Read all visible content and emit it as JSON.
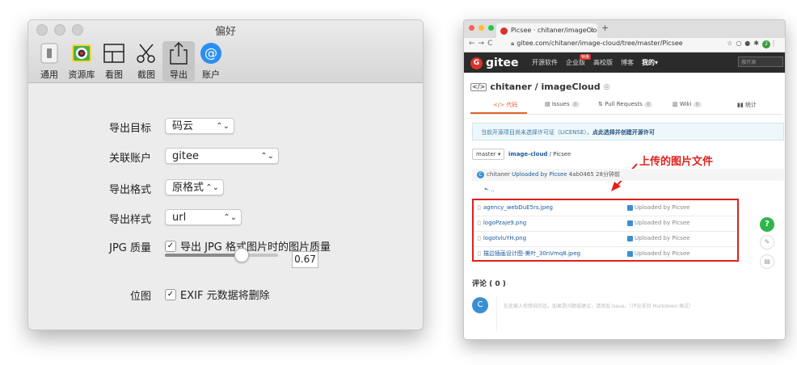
{
  "prefs": {
    "title": "偏好",
    "toolbar": [
      {
        "label": "通用",
        "icon": "switch-icon"
      },
      {
        "label": "资源库",
        "icon": "photo-library-icon"
      },
      {
        "label": "看图",
        "icon": "grid-view-icon"
      },
      {
        "label": "截图",
        "icon": "scissors-icon"
      },
      {
        "label": "导出",
        "icon": "share-export-icon",
        "selected": true
      },
      {
        "label": "账户",
        "icon": "at-sign-icon"
      }
    ],
    "export_target": {
      "label": "导出目标",
      "value": "码云"
    },
    "linked_account": {
      "label": "关联账户",
      "value": "gitee"
    },
    "export_format": {
      "label": "导出格式",
      "value": "原格式"
    },
    "export_style": {
      "label": "导出样式",
      "value": "url"
    },
    "jpg_quality": {
      "label": "JPG 质量",
      "checkbox_label": "导出 JPG 格式图片时的图片质量",
      "checked": true,
      "slider_value": 0.67,
      "value_text": "0.67"
    },
    "bitmap": {
      "label": "位图",
      "checkbox_label": "EXIF 元数据将删除",
      "checked": true
    }
  },
  "browser": {
    "tab_title": "Picsee · chitaner/imageCloud",
    "tab_close": "×",
    "new_tab": "+",
    "url": "gitee.com/chitaner/image-cloud/tree/master/Picsee",
    "ext_avatar": "2",
    "gitee": {
      "logo_mark": "G",
      "logo_text": "gitee",
      "nav": [
        "开源软件",
        "企业版",
        "高校版",
        "博客",
        "我的▾"
      ],
      "hot_badge": "特惠",
      "search_placeholder": "搜开源",
      "repo_title": "chitaner / imageCloud",
      "tabs": [
        {
          "label": "</> 代码",
          "count": ""
        },
        {
          "label": "Issues",
          "count": "0"
        },
        {
          "label": "Pull Requests",
          "count": "0"
        },
        {
          "label": "Wiki",
          "count": "0"
        },
        {
          "label": "统计",
          "count": ""
        }
      ],
      "license_text": "当前开源项目尚未选择许可证（LICENSE），",
      "license_link": "点此选择并创建开源许可",
      "branch": "master ▾",
      "breadcrumb_repo": "image-cloud",
      "breadcrumb_path": " / Picsee",
      "annotation": "上传的图片文件",
      "commit": {
        "avatar": "C",
        "author": "chitaner",
        "message": "Uploaded by Picsee",
        "hash": "4ab0465",
        "time": "28分钟前"
      },
      "back": "⬑ ..",
      "files": [
        {
          "name": "agency_webDuE5rs.jpeg",
          "message": "Uploaded by Picsee"
        },
        {
          "name": "logoPzaje9.png",
          "message": "Uploaded by Picsee"
        },
        {
          "name": "logotvluYH.png",
          "message": "Uploaded by Picsee"
        },
        {
          "name": "描边插画设计图-美叶_30nVmq8.jpeg",
          "message": "Uploaded by Picsee"
        }
      ],
      "help": "?",
      "comments_heading": "评论 ( 0 )",
      "comment_avatar": "C",
      "comment_placeholder": "在此输入你想说的话，如果是问题或建议，请添加 Issue。（评论支持 Markdown 格式）"
    }
  }
}
